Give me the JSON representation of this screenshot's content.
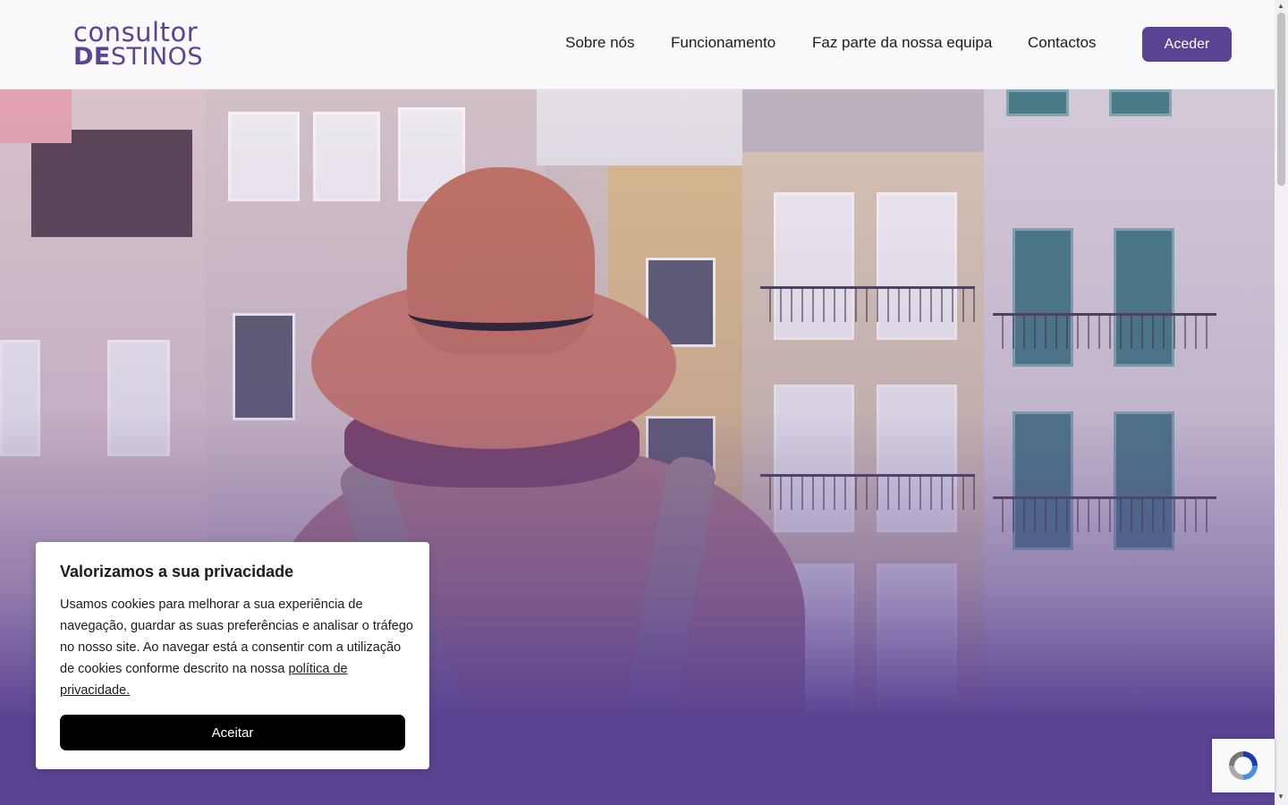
{
  "brand": {
    "logo_top": "consultor",
    "logo_bottom_bold": "DE",
    "logo_bottom_rest": "STINOS",
    "accent_color": "#5a4392"
  },
  "nav": {
    "items": [
      {
        "label": "Sobre nós"
      },
      {
        "label": "Funcionamento"
      },
      {
        "label": "Faz parte da nossa equipa"
      },
      {
        "label": "Contactos"
      }
    ],
    "cta_label": "Aceder"
  },
  "cookie_banner": {
    "title": "Valorizamos a sua privacidade",
    "body": "Usamos cookies para melhorar a sua experiência de navegação, guardar as suas preferências e analisar o tráfego no nosso site. Ao navegar está a consentir com a utilização de cookies conforme descrito na nossa",
    "link_label": "política de privacidade.",
    "accept_label": "Aceitar"
  },
  "icons": {
    "recaptcha": "recaptcha-icon",
    "scroll_up": "scroll-up-arrow-icon",
    "scroll_down": "scroll-down-arrow-icon"
  }
}
